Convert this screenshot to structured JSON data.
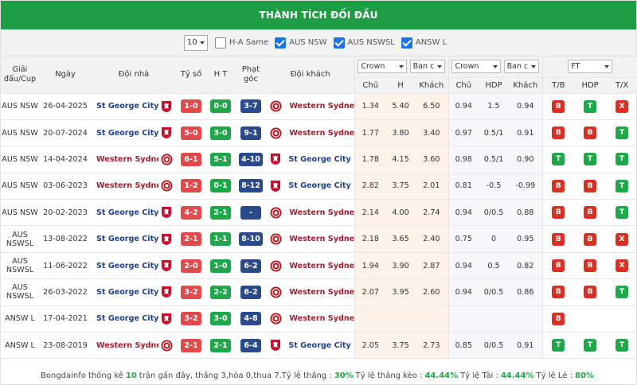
{
  "header": {
    "title": "THÀNH TÍCH ĐỐI ĐẦU"
  },
  "filters": {
    "count": "10",
    "options": [
      {
        "label": "H-A Same",
        "checked": false
      },
      {
        "label": "AUS NSW",
        "checked": true
      },
      {
        "label": "AUS NSWSL",
        "checked": true
      },
      {
        "label": "ANSW L",
        "checked": true
      }
    ]
  },
  "columns": {
    "league": "Giải đấu/Cup",
    "date": "Ngày",
    "home": "Đội nhà",
    "score": "Tỷ số",
    "ht": "H T",
    "corner": "Phạt góc",
    "away": "Đội khách",
    "book1": "Crown",
    "book1b": "Ban c",
    "book2": "Crown",
    "book2b": "Ban c",
    "ft": "FT",
    "sub": [
      "Chủ",
      "H",
      "Khách",
      "Chủ",
      "HDP",
      "Khách",
      "T/B",
      "HDP",
      "T/X"
    ]
  },
  "rows": [
    {
      "league": "AUS NSW",
      "date": "26-04-2025",
      "home": "St George City ...",
      "home_side": "stgeorge",
      "score": "1-0",
      "score_color": "red",
      "ht": "0-0",
      "corner": "3-7",
      "away": "Western Sydne...",
      "away_side": "western",
      "o1": "1.34",
      "o2": "5.40",
      "o3": "6.50",
      "h1": "0.94",
      "h2": "1.5",
      "h3": "0.94",
      "tb": "B",
      "hdp": "T",
      "tx": "X"
    },
    {
      "league": "AUS NSW",
      "date": "20-07-2024",
      "home": "St George City ...",
      "home_side": "stgeorge",
      "score": "5-0",
      "score_color": "red",
      "ht": "3-0",
      "corner": "9-1",
      "away": "Western Sydne...",
      "away_side": "western",
      "o1": "1.77",
      "o2": "3.80",
      "o3": "3.40",
      "h1": "0.97",
      "h2": "0.5/1",
      "h3": "0.91",
      "tb": "B",
      "hdp": "B",
      "tx": "T"
    },
    {
      "league": "AUS NSW",
      "date": "14-04-2024",
      "home": "Western Sydne...",
      "home_side": "western",
      "score": "6-1",
      "score_color": "red",
      "ht": "5-1",
      "corner": "4-10",
      "away": "St George City ...",
      "away_side": "stgeorge",
      "o1": "1.78",
      "o2": "4.15",
      "o3": "3.60",
      "h1": "0.98",
      "h2": "0.5/1",
      "h3": "0.90",
      "tb": "T",
      "hdp": "T",
      "tx": "T"
    },
    {
      "league": "AUS NSW",
      "date": "03-06-2023",
      "home": "Western Sydne...",
      "home_side": "western",
      "score": "1-2",
      "score_color": "red",
      "ht": "0-1",
      "corner": "8-12",
      "away": "St George City ...",
      "away_side": "stgeorge",
      "o1": "2.82",
      "o2": "3.75",
      "o3": "2.01",
      "h1": "0.81",
      "h2": "-0.5",
      "h3": "-0.99",
      "tb": "B",
      "hdp": "B",
      "tx": "T"
    },
    {
      "league": "AUS NSW",
      "date": "20-02-2023",
      "home": "St George City ...",
      "home_side": "stgeorge",
      "score": "4-2",
      "score_color": "red",
      "ht": "2-1",
      "corner": "-",
      "away": "Western Sydne...",
      "away_side": "western",
      "o1": "2.14",
      "o2": "4.00",
      "o3": "2.74",
      "h1": "0.94",
      "h2": "0/0.5",
      "h3": "0.88",
      "tb": "B",
      "hdp": "B",
      "tx": "T"
    },
    {
      "league": "AUS NSWSL",
      "date": "13-08-2022",
      "home": "St George City ...",
      "home_side": "stgeorge",
      "score": "2-1",
      "score_color": "red",
      "ht": "1-1",
      "corner": "8-10",
      "away": "Western Sydne...",
      "away_side": "western",
      "o1": "2.18",
      "o2": "3.65",
      "o3": "2.40",
      "h1": "0.75",
      "h2": "0",
      "h3": "0.95",
      "tb": "B",
      "hdp": "B",
      "tx": "X"
    },
    {
      "league": "AUS NSWSL",
      "date": "11-06-2022",
      "home": "St George City ...",
      "home_side": "stgeorge",
      "score": "2-0",
      "score_color": "red",
      "ht": "1-0",
      "corner": "6-2",
      "away": "Western Sydne...",
      "away_side": "western",
      "o1": "1.94",
      "o2": "3.90",
      "o3": "2.87",
      "h1": "0.94",
      "h2": "0.5",
      "h3": "0.82",
      "tb": "B",
      "hdp": "B",
      "tx": "X"
    },
    {
      "league": "AUS NSWSL",
      "date": "26-03-2022",
      "home": "St George City ...",
      "home_side": "stgeorge",
      "score": "3-2",
      "score_color": "red",
      "ht": "2-2",
      "corner": "6-2",
      "away": "Western Sydne...",
      "away_side": "western",
      "o1": "2.07",
      "o2": "3.95",
      "o3": "2.60",
      "h1": "0.94",
      "h2": "0/0.5",
      "h3": "0.86",
      "tb": "B",
      "hdp": "B",
      "tx": "T"
    },
    {
      "league": "ANSW L",
      "date": "17-04-2021",
      "home": "St George City ...",
      "home_side": "stgeorge",
      "score": "3-2",
      "score_color": "red",
      "ht": "3-0",
      "corner": "4-8",
      "away": "Western Sydne...",
      "away_side": "western",
      "o1": "",
      "o2": "",
      "o3": "",
      "h1": "",
      "h2": "",
      "h3": "",
      "tb": "B",
      "hdp": "",
      "tx": ""
    },
    {
      "league": "ANSW L",
      "date": "23-08-2019",
      "home": "Western Sydne...",
      "home_side": "western",
      "score": "2-1",
      "score_color": "red",
      "ht": "2-1",
      "corner": "6-4",
      "away": "St George City ...",
      "away_side": "stgeorge",
      "o1": "2.05",
      "o2": "3.75",
      "o3": "2.73",
      "h1": "0.85",
      "h2": "0/0.5",
      "h3": "0.91",
      "tb": "T",
      "hdp": "T",
      "tx": "T"
    }
  ],
  "footer": {
    "p1": "Bongdainfo thống kê",
    "n": "10",
    "p2": "trận gần đây, thắng 3,hòa 0,thua 7.Tỷ lệ thắng :",
    "win": "30%",
    "p3": "Tỷ lệ thắng kèo :",
    "handicap": "44.44%",
    "p4": "Tỷ lệ Tài :",
    "over": "44.44%",
    "p5": "Tỷ lệ Lẻ :",
    "odd": "80%"
  },
  "colors": {
    "header_green": "#1f9d45",
    "badge_red": "#e14a4a",
    "badge_green": "#1fa84a",
    "badge_navy": "#2b4a8c",
    "home_blue": "#1f3f8f",
    "home_red": "#a51d2e"
  },
  "icons": {
    "stgeorge": "red-crest-icon",
    "western": "red-roundel-icon"
  }
}
